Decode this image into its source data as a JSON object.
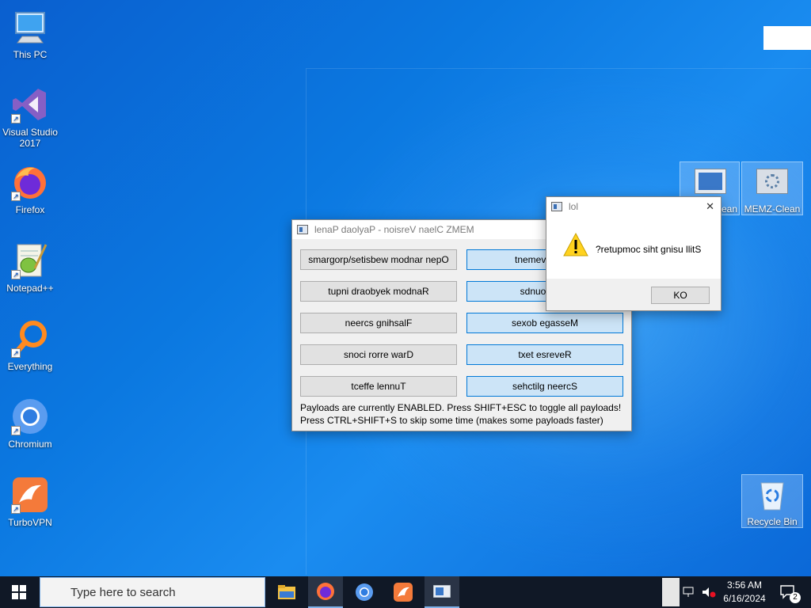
{
  "desktop": {
    "icons": [
      {
        "label": "This PC",
        "icon": "computer-icon"
      },
      {
        "label": "Visual Studio 2017",
        "icon": "visual-studio-icon"
      },
      {
        "label": "Firefox",
        "icon": "firefox-icon"
      },
      {
        "label": "Notepad++",
        "icon": "notepad-plus-plus-icon"
      },
      {
        "label": "Everything",
        "icon": "everything-search-icon"
      },
      {
        "label": "Chromium",
        "icon": "chromium-icon"
      },
      {
        "label": "TurboVPN",
        "icon": "turbovpn-icon"
      }
    ],
    "right_icons": [
      {
        "label": "ean",
        "icon": "memz-icon"
      },
      {
        "label": "MEMZ-Clean",
        "icon": "memz-clean-icon"
      },
      {
        "label": "Recycle Bin",
        "icon": "recycle-bin-icon"
      }
    ]
  },
  "memz_window": {
    "title": "lenaP daolyaP - noisreV naelC ZMEM",
    "left_buttons": [
      "smargorp/setisbew modnar nepO",
      "tupni draobyek modnaR",
      "neercs gnihsalF",
      "snoci rorre warD",
      "tceffe lennuT"
    ],
    "right_buttons": [
      "tnemevom ros",
      "sdnuos rom",
      "sexob egasseM",
      "txet esreveR",
      "sehctilg neercS"
    ],
    "status_line_1": "Payloads are currently ENABLED. Press SHIFT+ESC to toggle all payloads!",
    "status_line_2": "Press CTRL+SHIFT+S to skip some time (makes some payloads faster)"
  },
  "dialog": {
    "title": "lol",
    "message": "?retupmoc siht gnisu llitS",
    "ok_label": "KO",
    "close_glyph": "✕"
  },
  "taskbar": {
    "search_placeholder": "Type here to search",
    "time": "3:56 AM",
    "date": "6/16/2024",
    "notification_count": "2"
  },
  "colors": {
    "accent": "#0078d7",
    "toggled_button": "#cce4f7",
    "taskbar": "#101826"
  }
}
